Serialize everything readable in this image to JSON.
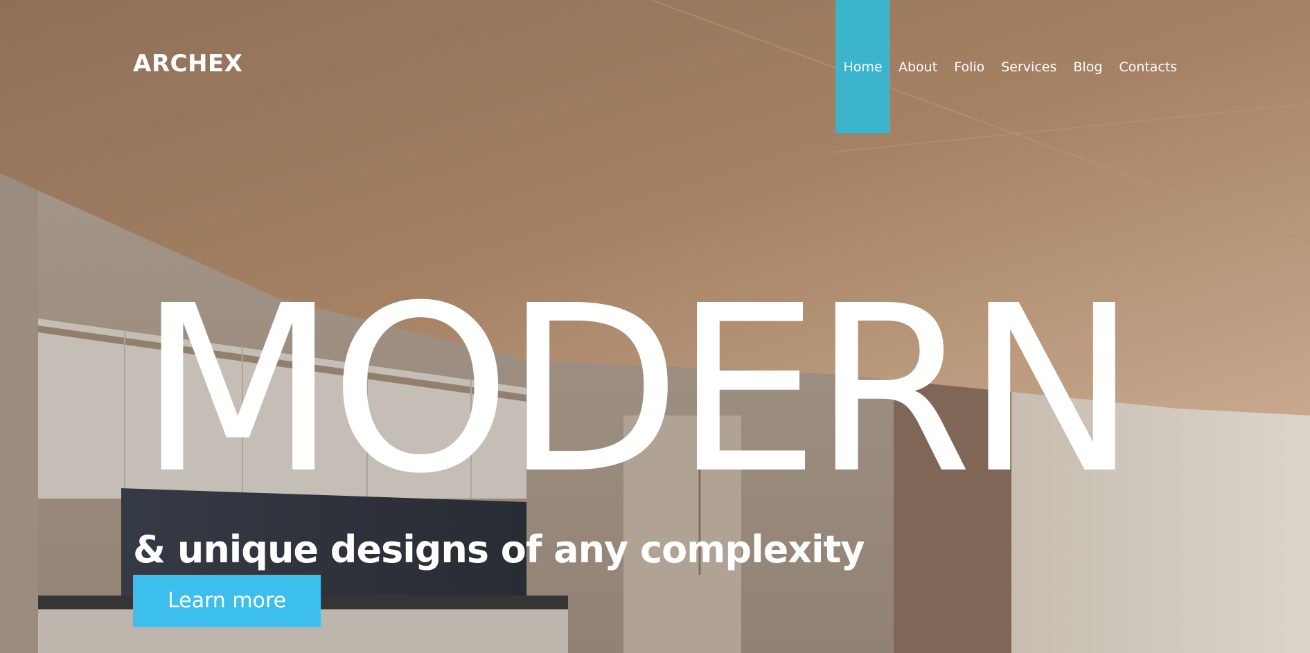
{
  "brand": {
    "logo_text": "ARCHEX"
  },
  "nav": {
    "items": [
      {
        "label": "Home",
        "active": true
      },
      {
        "label": "About",
        "active": false
      },
      {
        "label": "Folio",
        "active": false
      },
      {
        "label": "Services",
        "active": false
      },
      {
        "label": "Blog",
        "active": false
      },
      {
        "label": "Contacts",
        "active": false
      }
    ]
  },
  "hero": {
    "headline": "MODERN",
    "subtitle": "& unique designs of any complexity",
    "cta_label": "Learn more"
  },
  "colors": {
    "accent_nav": "#3bb4cc",
    "accent_button": "#3cbfec",
    "text": "#ffffff"
  }
}
